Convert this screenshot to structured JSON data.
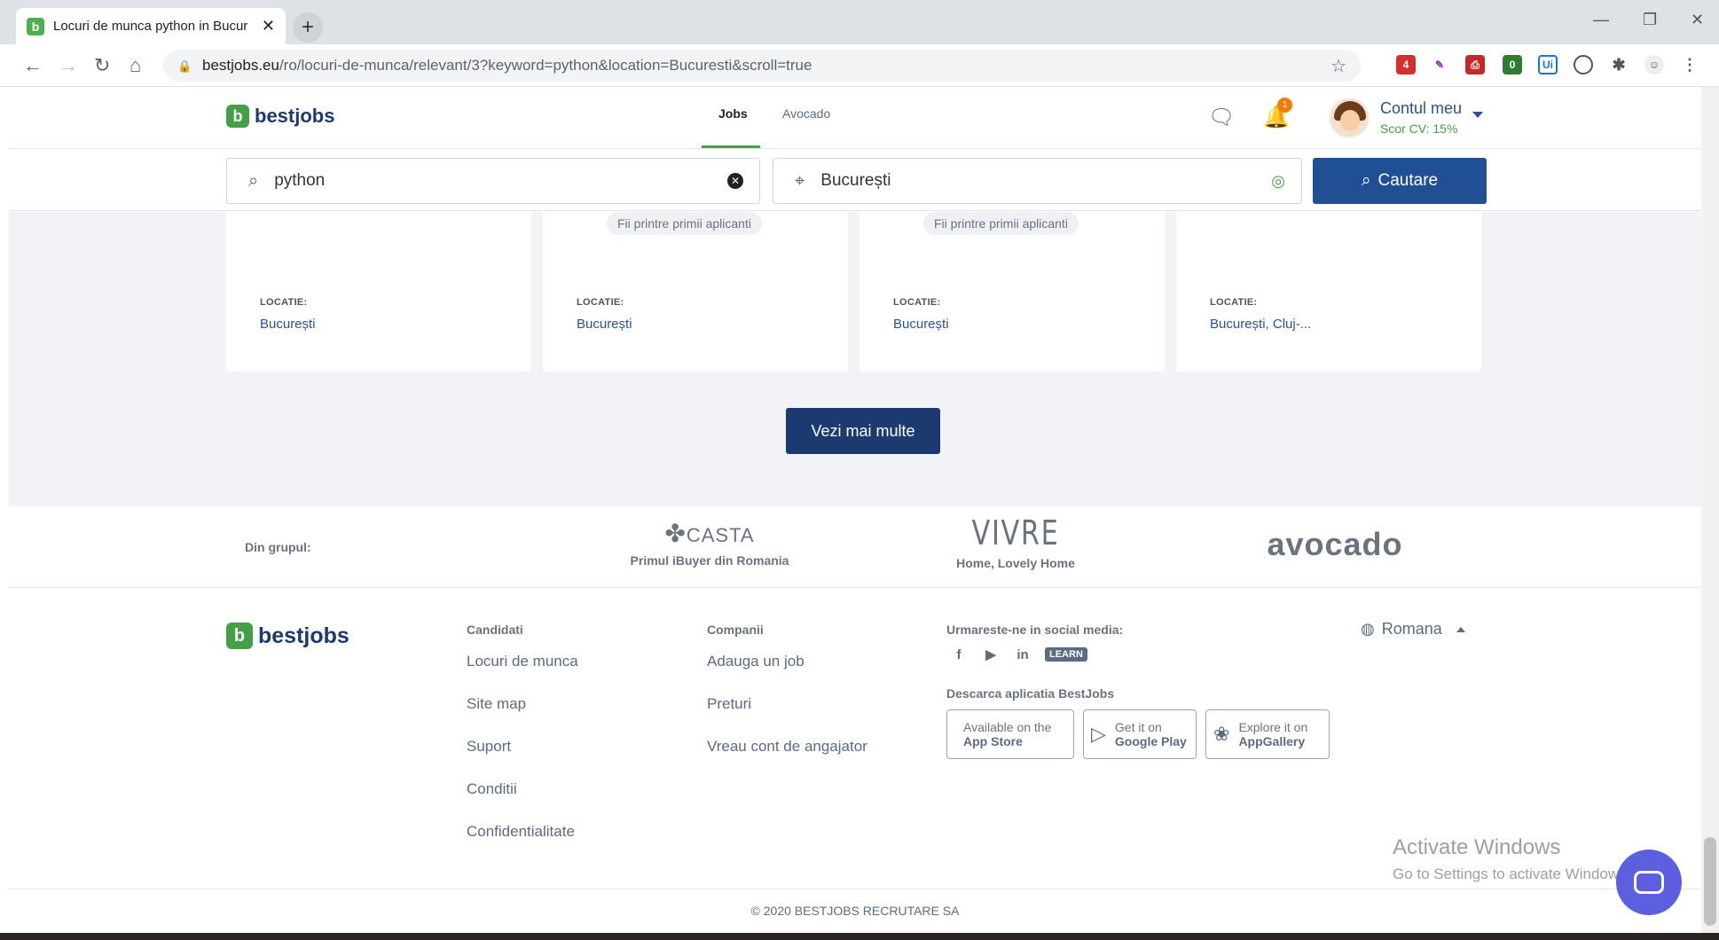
{
  "browser": {
    "tab_title": "Locuri de munca python in Bucur",
    "tab_close": "✕",
    "new_tab": "+",
    "url_domain": "bestjobs.eu",
    "url_path": "/ro/locuri-de-munca/relevant/3?keyword=python&location=Bucuresti&scroll=true",
    "ext_badge_1": "4",
    "ext_badge_2": "0",
    "ext_label_ui": "Ui"
  },
  "header": {
    "logo": "bestjobs",
    "nav": [
      "Jobs",
      "Avocado"
    ],
    "notification_count": "1",
    "account_name": "Contul meu",
    "cv_score": "Scor CV: 15%"
  },
  "search": {
    "keyword": "python",
    "location": "București",
    "button": "Cautare"
  },
  "results": {
    "cards": [
      {
        "chip": "",
        "loc_label": "LOCATIE:",
        "location": "București"
      },
      {
        "chip": "Fii printre primii aplicanti",
        "loc_label": "LOCATIE:",
        "location": "București"
      },
      {
        "chip": "Fii printre primii aplicanti",
        "loc_label": "LOCATIE:",
        "location": "București"
      },
      {
        "chip": "",
        "loc_label": "LOCATIE:",
        "location": "București, Cluj-..."
      }
    ],
    "more_button": "Vezi mai multe"
  },
  "group": {
    "label": "Din grupul:",
    "partners": [
      {
        "brand": "CASTA",
        "tagline": "Primul iBuyer din Romania"
      },
      {
        "brand": "VIVRE",
        "tagline": "Home, Lovely Home"
      },
      {
        "brand": "avocado",
        "tagline": ""
      }
    ]
  },
  "footer": {
    "logo": "bestjobs",
    "candidati_title": "Candidati",
    "candidati_links": [
      "Locuri de munca",
      "Site map",
      "Suport",
      "Conditii",
      "Confidentialitate"
    ],
    "companii_title": "Companii",
    "companii_links": [
      "Adauga un job",
      "Preturi",
      "Vreau cont de angajator"
    ],
    "social_title": "Urmareste-ne in social media:",
    "social_learn": "LEARN",
    "app_title": "Descarca aplicatia BestJobs",
    "stores": [
      {
        "line1": "Available on the",
        "line2": "App Store"
      },
      {
        "line1": "Get it on",
        "line2": "Google Play"
      },
      {
        "line1": "Explore it on",
        "line2": "AppGallery"
      }
    ],
    "language": "Romana",
    "copyright": "© 2020 BESTJOBS RECRUTARE SA"
  },
  "overlay": {
    "activate_title": "Activate Windows",
    "activate_sub": "Go to Settings to activate Windows."
  }
}
